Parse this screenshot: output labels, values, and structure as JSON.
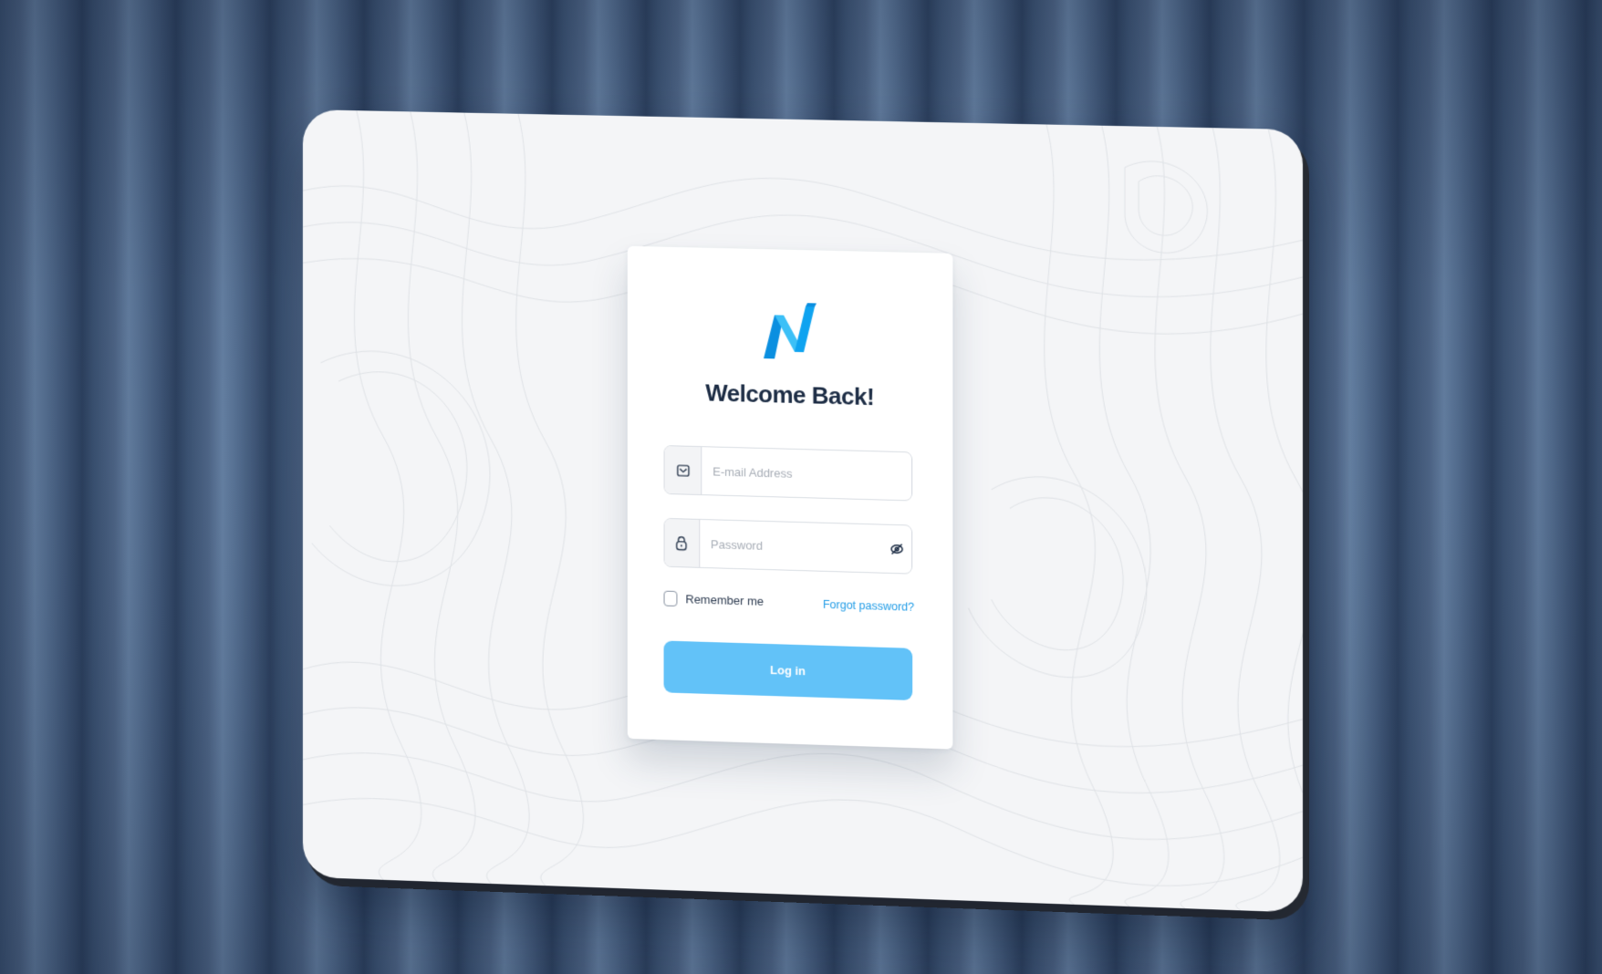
{
  "login": {
    "title": "Welcome Back!",
    "email_placeholder": "E-mail Address",
    "password_placeholder": "Password",
    "remember_label": "Remember me",
    "forgot_label": "Forgot password?",
    "login_label": "Log in"
  },
  "icons": {
    "logo": "brand-n-logo",
    "email": "envelope-icon",
    "password": "lock-icon",
    "toggle_visibility": "eye-slash-icon"
  },
  "colors": {
    "brand_blue": "#1f9be6",
    "logo_blue": "#0fa3f0",
    "button": "#62c2f8",
    "title": "#1c2c44",
    "panel": "#f4f5f7"
  }
}
